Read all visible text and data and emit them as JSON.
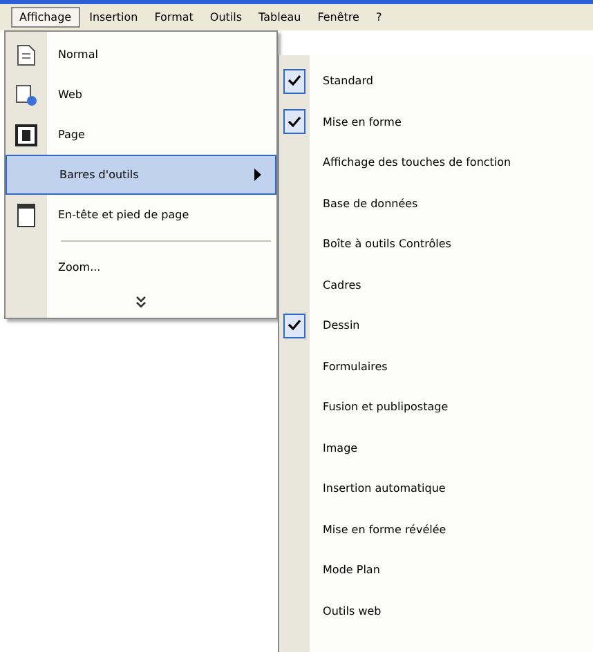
{
  "menu_bar": [
    {
      "label": "Affichage",
      "selected": true
    },
    {
      "label": "Insertion",
      "selected": false
    },
    {
      "label": "Format",
      "selected": false
    },
    {
      "label": "Outils",
      "selected": false
    },
    {
      "label": "Tableau",
      "selected": false
    },
    {
      "label": "Fenêtre",
      "selected": false
    },
    {
      "label": "?",
      "selected": false
    }
  ],
  "menu": {
    "items": [
      {
        "label": "Normal",
        "kind": "normal",
        "selected": false,
        "submenu": false
      },
      {
        "label": "Web",
        "kind": "web",
        "selected": false,
        "submenu": false
      },
      {
        "label": "Page",
        "kind": "page",
        "selected": false,
        "submenu": false
      },
      {
        "label": "Barres d'outils",
        "kind": "plain",
        "selected": true,
        "submenu": true
      },
      {
        "label": "En-tête et pied de page",
        "kind": "header",
        "selected": false,
        "submenu": false
      },
      {
        "label": "Zoom...",
        "kind": "plain",
        "selected": false,
        "submenu": false,
        "separator_before": true
      }
    ],
    "more": true
  },
  "submenu": {
    "items": [
      {
        "label": "Standard",
        "checked": true
      },
      {
        "label": "Mise en forme",
        "checked": true
      },
      {
        "label": "Affichage des touches de fonction",
        "checked": false
      },
      {
        "label": "Base de données",
        "checked": false
      },
      {
        "label": "Boîte à outils Contrôles",
        "checked": false
      },
      {
        "label": "Cadres",
        "checked": false
      },
      {
        "label": "Dessin",
        "checked": true
      },
      {
        "label": "Formulaires",
        "checked": false
      },
      {
        "label": "Fusion et publipostage",
        "checked": false
      },
      {
        "label": "Image",
        "checked": false
      },
      {
        "label": "Insertion automatique",
        "checked": false
      },
      {
        "label": "Mise en forme révélée",
        "checked": false
      },
      {
        "label": "Mode Plan",
        "checked": false
      },
      {
        "label": "Outils web",
        "checked": false
      }
    ]
  }
}
